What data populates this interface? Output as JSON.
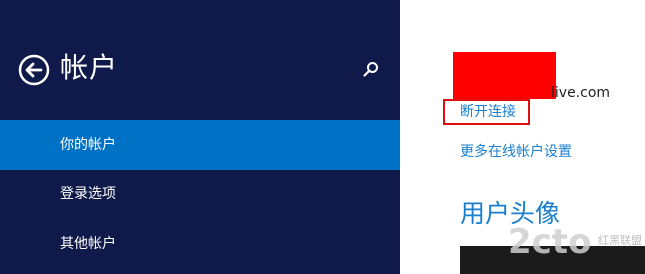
{
  "nav": {
    "title": "帐户",
    "back_icon": "back-arrow-circle-icon",
    "search_icon": "search-icon",
    "items": [
      {
        "label": "你的帐户",
        "selected": true
      },
      {
        "label": "登录选项",
        "selected": false
      },
      {
        "label": "其他帐户",
        "selected": false
      }
    ]
  },
  "content": {
    "email_suffix": "live.com",
    "disconnect_link": "断开连接",
    "more_settings_link": "更多在线帐户设置",
    "avatar_heading": "用户头像"
  },
  "watermark": {
    "logo_text": "2cto",
    "sub_text": "红黑联盟"
  },
  "colors": {
    "nav_background": "#0f1a4a",
    "selected_item": "#0072c6",
    "link": "#1a7fcf",
    "redaction": "#ff0000",
    "highlight_box": "#e11010"
  }
}
